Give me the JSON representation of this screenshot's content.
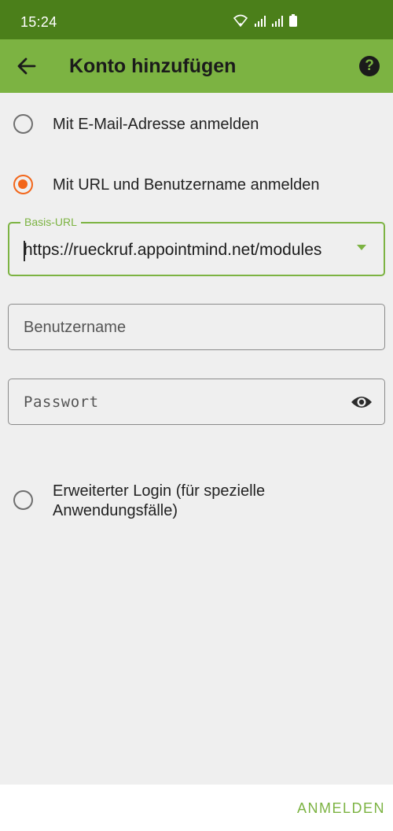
{
  "status_bar": {
    "time": "15:24",
    "icons": [
      "wifi-icon",
      "signal-icon",
      "signal-icon",
      "battery-icon"
    ]
  },
  "app_bar": {
    "title": "Konto hinzufügen",
    "back_icon": "arrow-left-icon",
    "help_icon": "help-circle-icon",
    "help_glyph": "?"
  },
  "login_options": [
    {
      "label": "Mit E-Mail-Adresse anmelden",
      "selected": false
    },
    {
      "label": "Mit URL und Benutzername anmelden",
      "selected": true
    }
  ],
  "form": {
    "base_url": {
      "label": "Basis-URL",
      "value": "https://rueckruf.appointmind.net/modules"
    },
    "username": {
      "placeholder": "Benutzername",
      "value": ""
    },
    "password": {
      "placeholder": "Passwort",
      "value": "",
      "toggle_icon": "eye-icon"
    }
  },
  "advanced_login": {
    "label_line1": "Erweiterter Login (für spezielle",
    "label_line2": "Anwendungsfälle)",
    "selected": false
  },
  "footer": {
    "submit_label": "ANMELDEN"
  },
  "colors": {
    "status_bar": "#4b7f1a",
    "app_bar": "#7cb342",
    "accent": "#7cb342",
    "radio_selected": "#f2661a",
    "background": "#efefef"
  }
}
